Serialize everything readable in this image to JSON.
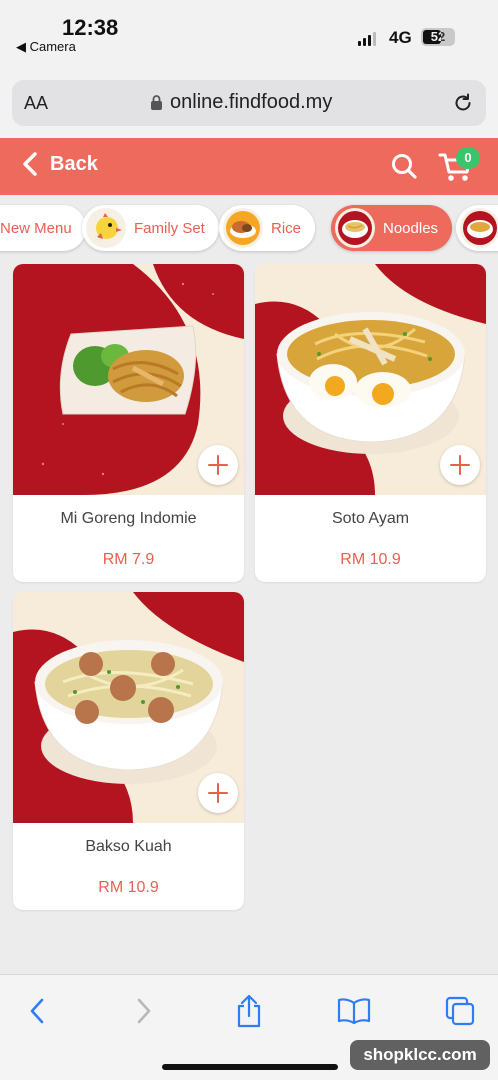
{
  "status_bar": {
    "time": "12:38",
    "back_app": "◀ Camera",
    "network": "4G",
    "battery": "52"
  },
  "browser": {
    "text_size_label": "AA",
    "url": "online.findfood.my"
  },
  "header": {
    "back_label": "Back",
    "cart_count": "0",
    "accent_color": "#ee6a5c",
    "badge_color": "#3ac46c"
  },
  "categories": [
    {
      "label": "New Menu",
      "active": false,
      "icon": "new-menu-icon"
    },
    {
      "label": "Family Set",
      "active": false,
      "icon": "chick-mascot-icon"
    },
    {
      "label": "Rice",
      "active": false,
      "icon": "rice-bowl-icon"
    },
    {
      "label": "Noodles",
      "active": true,
      "icon": "noodle-bowl-icon"
    },
    {
      "label": "",
      "active": false,
      "icon": "soup-bowl-icon"
    }
  ],
  "products": [
    {
      "name": "Mi Goreng Indomie",
      "price": "RM 7.9",
      "image": "fried-noodles-plate"
    },
    {
      "name": "Soto Ayam",
      "price": "RM 10.9",
      "image": "soto-ayam-bowl"
    },
    {
      "name": "Bakso Kuah",
      "price": "RM 10.9",
      "image": "bakso-soup-bowl"
    }
  ],
  "watermark": "shopklcc.com"
}
